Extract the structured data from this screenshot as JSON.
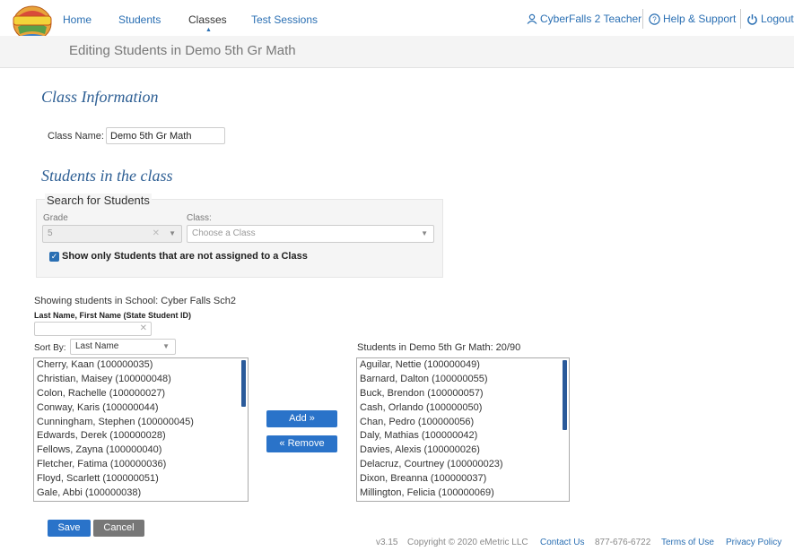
{
  "nav": {
    "home": "Home",
    "students": "Students",
    "classes": "Classes",
    "test_sessions": "Test Sessions",
    "user": "CyberFalls 2 Teacher",
    "help": "Help & Support",
    "logout": "Logout"
  },
  "page_title": "Editing Students in Demo 5th Gr Math",
  "class_info": {
    "heading": "Class Information",
    "name_label": "Class Name:",
    "name_value": "Demo 5th Gr Math"
  },
  "students_section": {
    "heading": "Students in the class",
    "search_title": "Search for Students",
    "grade_label": "Grade",
    "grade_value": "5",
    "class_label": "Class:",
    "class_placeholder": "Choose a Class",
    "checkbox_label": "Show only Students that are not assigned to a Class",
    "checkbox_checked": true
  },
  "left_list": {
    "showing_text": "Showing students in School: Cyber Falls Sch2",
    "filter_label": "Last Name, First Name (State Student ID)",
    "filter_value": "",
    "sort_label": "Sort By:",
    "sort_value": "Last Name",
    "items": [
      "Cherry, Kaan (100000035)",
      "Christian, Maisey (100000048)",
      "Colon, Rachelle (100000027)",
      "Conway, Karis (100000044)",
      "Cunningham, Stephen (100000045)",
      "Edwards, Derek (100000028)",
      "Fellows, Zayna (100000040)",
      "Fletcher, Fatima (100000036)",
      "Floyd, Scarlett (100000051)",
      "Gale, Abbi (100000038)"
    ]
  },
  "buttons": {
    "add": "Add »",
    "remove": "« Remove",
    "save": "Save",
    "cancel": "Cancel"
  },
  "right_list": {
    "title": "Students in Demo 5th Gr Math: 20/90",
    "items": [
      "Aguilar, Nettie (100000049)",
      "Barnard, Dalton (100000055)",
      "Buck, Brendon (100000057)",
      "Cash, Orlando (100000050)",
      "Chan, Pedro (100000056)",
      "Daly, Mathias (100000042)",
      "Davies, Alexis (100000026)",
      "Delacruz, Courtney (100000023)",
      "Dixon, Breanna (100000037)",
      "Millington, Felicia (100000069)"
    ]
  },
  "footer": {
    "version": "v3.15",
    "copyright": "Copyright © 2020 eMetric LLC",
    "contact": "Contact Us",
    "phone": "877-676-6722",
    "terms": "Terms of Use",
    "privacy": "Privacy Policy"
  },
  "colors": {
    "accent": "#2a73c9",
    "heading": "#2e5f94",
    "link": "#2a6fb3"
  }
}
